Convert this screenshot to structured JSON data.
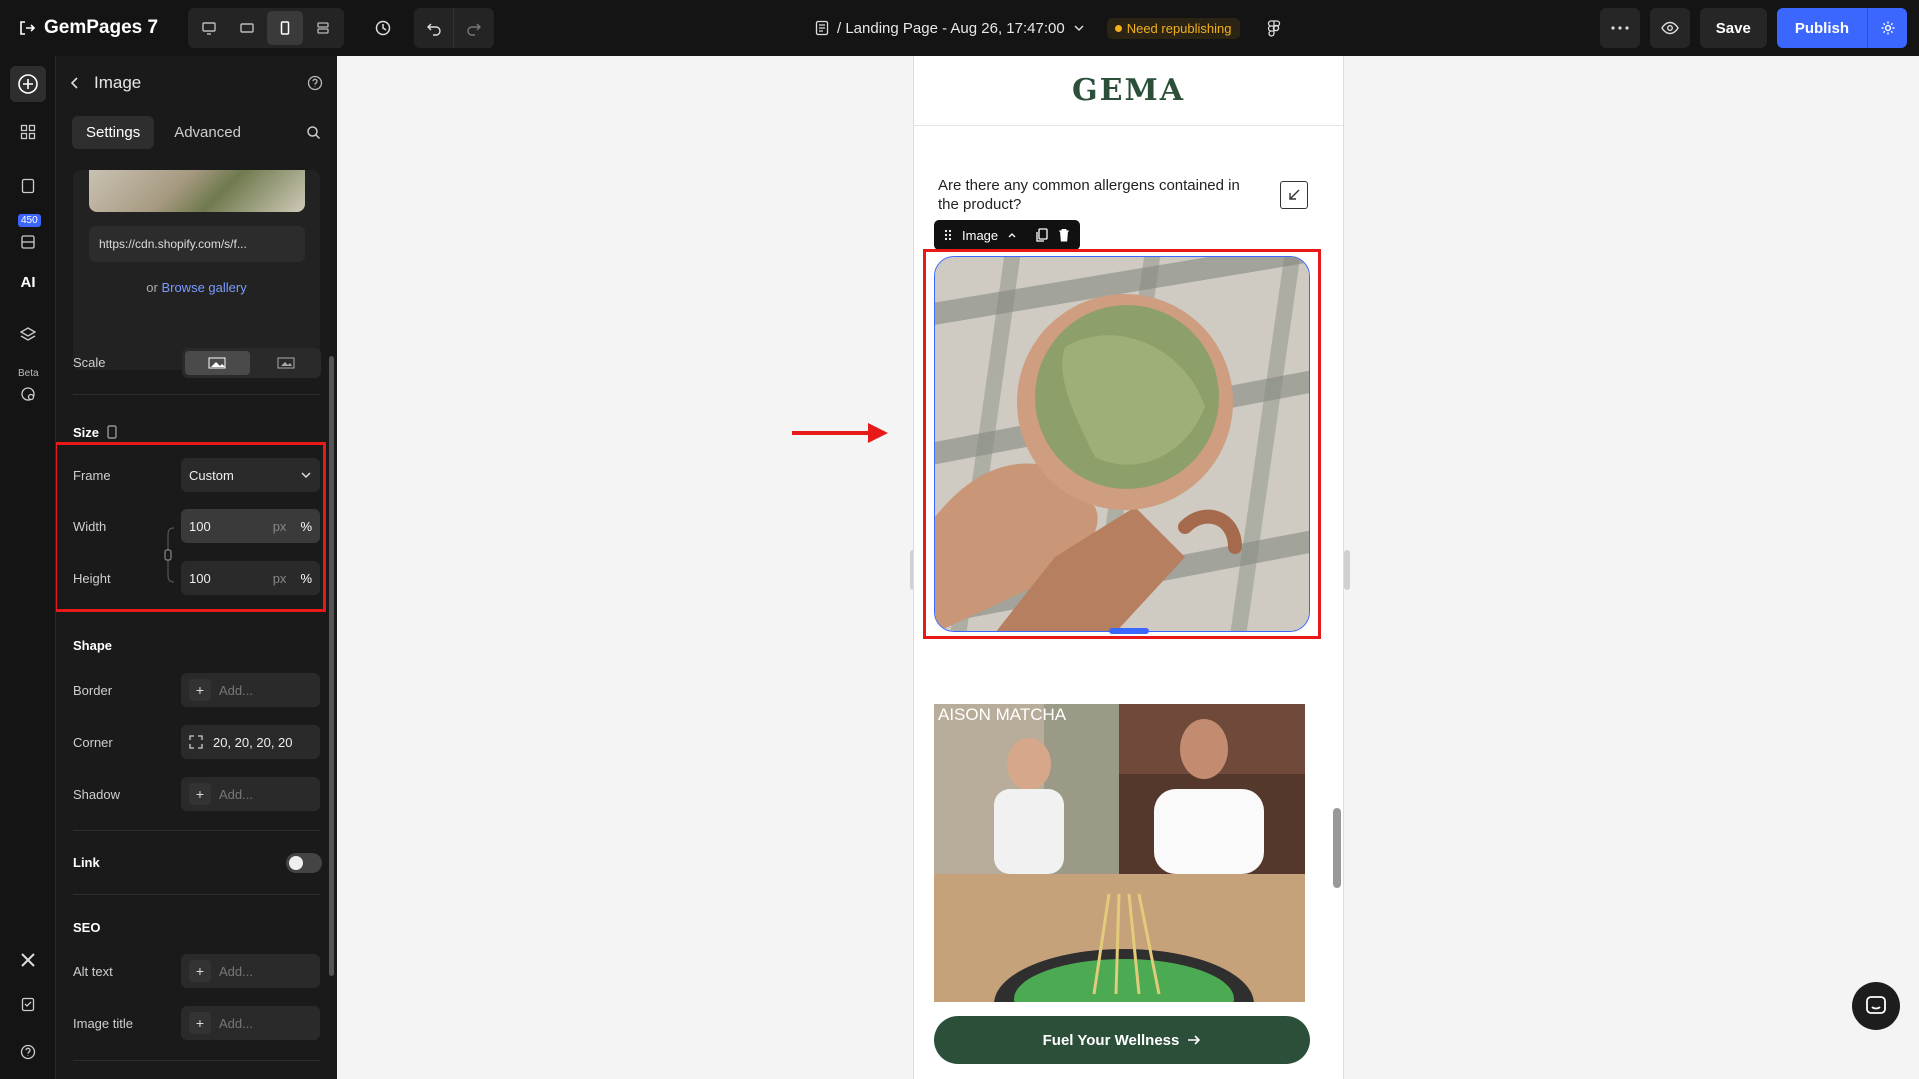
{
  "topbar": {
    "app_name": "GemPages 7",
    "page_title": "/ Landing Page - Aug 26, 17:47:00",
    "status_badge": "Need republishing",
    "save_label": "Save",
    "publish_label": "Publish"
  },
  "rail": {
    "badge_count": "450",
    "beta_label": "Beta",
    "ai_label": "AI"
  },
  "panel": {
    "title": "Image",
    "tabs": [
      "Settings",
      "Advanced"
    ],
    "image_url": "https://cdn.shopify.com/s/f...",
    "browse_prefix": "or",
    "browse_link": "Browse gallery",
    "scale_label": "Scale",
    "size_section": "Size",
    "frame_label": "Frame",
    "frame_value": "Custom",
    "width_label": "Width",
    "width_value": "100",
    "height_label": "Height",
    "height_value": "100",
    "unit_px": "px",
    "unit_pct": "%",
    "shape_section": "Shape",
    "border_label": "Border",
    "corner_label": "Corner",
    "corner_value": "20, 20, 20, 20",
    "shadow_label": "Shadow",
    "add_placeholder": "Add...",
    "link_label": "Link",
    "seo_section": "SEO",
    "alt_text_label": "Alt text",
    "image_title_label": "Image title"
  },
  "preview": {
    "logo_text": "GEMA",
    "faq_question": "Are there any common allergens contained in the product?",
    "image_toolbar_label": "Image",
    "collage_text": "AISON MATCHA",
    "cta_label": "Fuel Your Wellness"
  },
  "colors": {
    "brand_green": "#2c4f3a",
    "accent_blue": "#3c67ff",
    "highlight_red": "#e81919",
    "warning_yellow": "#f3b01b"
  }
}
